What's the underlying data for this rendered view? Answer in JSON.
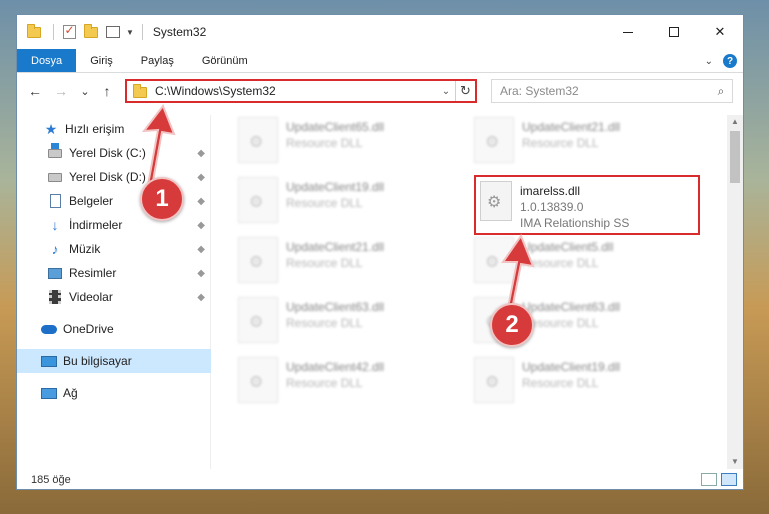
{
  "window": {
    "title": "System32",
    "controls": {
      "minimize": "",
      "maximize": "",
      "close": "✕"
    }
  },
  "ribbon": {
    "tabs": [
      "Dosya",
      "Giriş",
      "Paylaş",
      "Görünüm"
    ],
    "expand_icon": "chevron-down-icon",
    "help_label": "?"
  },
  "addressbar": {
    "back": "←",
    "forward": "→",
    "recent": "⌄",
    "up": "↑",
    "path": "C:\\Windows\\System32",
    "refresh": "↻",
    "dropdown": "⌄"
  },
  "search": {
    "placeholder": "Ara: System32",
    "icon_glyph": "⌕"
  },
  "sidebar": {
    "items": [
      {
        "label": "Hızlı erişim",
        "icon": "star-icon",
        "pinned": false
      },
      {
        "label": "Yerel Disk (C:)",
        "icon": "drive-windows-icon",
        "pinned": true
      },
      {
        "label": "Yerel Disk (D:)",
        "icon": "drive-icon",
        "pinned": true
      },
      {
        "label": "Belgeler",
        "icon": "documents-icon",
        "pinned": true
      },
      {
        "label": "İndirmeler",
        "icon": "downloads-icon",
        "pinned": true
      },
      {
        "label": "Müzik",
        "icon": "music-icon",
        "pinned": true
      },
      {
        "label": "Resimler",
        "icon": "pictures-icon",
        "pinned": true
      },
      {
        "label": "Videolar",
        "icon": "videos-icon",
        "pinned": true
      },
      {
        "label": "OneDrive",
        "icon": "onedrive-icon",
        "pinned": false
      },
      {
        "label": "Bu bilgisayar",
        "icon": "this-pc-icon",
        "pinned": false
      },
      {
        "label": "Ağ",
        "icon": "network-icon",
        "pinned": false
      }
    ],
    "pin_glyph": "📌"
  },
  "files": [
    {
      "name": "UpdateClient65.dll",
      "line2": "Resource DLL",
      "line3": ""
    },
    {
      "name": "UpdateClient21.dll",
      "line2": "Resource DLL",
      "line3": ""
    },
    {
      "name": "UpdateClient19.dll",
      "line2": "Resource DLL",
      "line3": ""
    },
    {
      "name": "imarelss.dll",
      "line2": "1.0.13839.0",
      "line3": "IMA Relationship SS"
    },
    {
      "name": "UpdateClient21.dll",
      "line2": "Resource DLL",
      "line3": ""
    },
    {
      "name": "UpdateClient5.dll",
      "line2": "Resource DLL",
      "line3": ""
    },
    {
      "name": "UpdateClient63.dll",
      "line2": "Resource DLL",
      "line3": ""
    },
    {
      "name": "UpdateClient63.dll",
      "line2": "Resource DLL",
      "line3": ""
    },
    {
      "name": "UpdateClient42.dll",
      "line2": "Resource DLL",
      "line3": ""
    },
    {
      "name": "UpdateClient19.dll",
      "line2": "Resource DLL",
      "line3": ""
    }
  ],
  "status": {
    "item_count": "185 öğe"
  },
  "annotations": {
    "step1": "1",
    "step2": "2",
    "color": "#d63a3a"
  },
  "colors": {
    "accent": "#1979ca",
    "highlight_border": "#d92b2b",
    "selected_bg": "#cce8ff"
  }
}
